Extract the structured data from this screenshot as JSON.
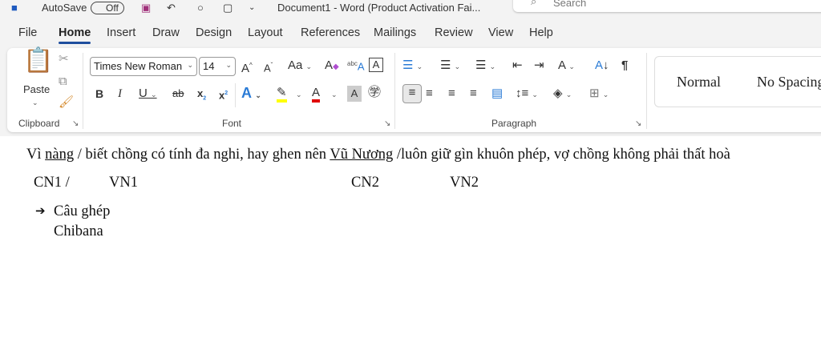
{
  "titlebar": {
    "autosave": "AutoSave",
    "toggle": "Off",
    "title": "Document1 - Word (Product Activation Fai...",
    "search_placeholder": "Search"
  },
  "tabs": [
    "File",
    "Home",
    "Insert",
    "Draw",
    "Design",
    "Layout",
    "References",
    "Mailings",
    "Review",
    "View",
    "Help"
  ],
  "ribbon": {
    "clipboard": {
      "paste": "Paste",
      "label": "Clipboard"
    },
    "font": {
      "name": "Times New Roman",
      "size": "14",
      "label": "Font"
    },
    "paragraph": {
      "label": "Paragraph"
    },
    "styles": [
      "Normal",
      "No Spacing"
    ]
  },
  "colors": {
    "highlight": "#ffff00",
    "font_color": "#e00000",
    "accent": "#1f4e9e"
  },
  "document": {
    "line1": {
      "p1": "Vì ",
      "u1": "nàng",
      "p2": " / biết chồng có tính đa nghi, hay ghen nên ",
      "u2": "Vũ Nương",
      "p3": " /luôn giữ gìn khuôn phép, vợ chồng không phải thất hoà"
    },
    "labels": {
      "cn1": "CN1  /",
      "vn1": "VN1",
      "cn2": "CN2",
      "vn2": "VN2"
    },
    "arrow": "➔",
    "conclusion": "Câu ghép",
    "note": "Chibana"
  }
}
